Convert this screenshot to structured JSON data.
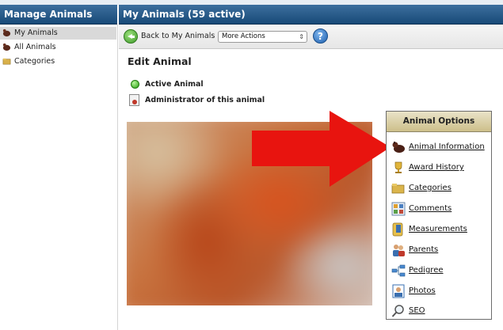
{
  "left_header": {
    "title": "Manage Animals"
  },
  "right_header": {
    "title": "My Animals (59 active)"
  },
  "sidebar": {
    "items": [
      {
        "label": "My Animals",
        "icon": "animal-icon",
        "active": true
      },
      {
        "label": "All Animals",
        "icon": "animal-icon",
        "active": false
      },
      {
        "label": "Categories",
        "icon": "folder-icon",
        "active": false
      }
    ]
  },
  "toolbar": {
    "back_label": "Back to My Animals",
    "more_actions_value": "More Actions",
    "help_label": "?"
  },
  "main": {
    "title": "Edit Animal",
    "status_active": "Active Animal",
    "status_admin": "Administrator of this animal"
  },
  "options": {
    "title": "Animal Options",
    "items": [
      {
        "label": "Animal Information",
        "icon": "animal-info-icon"
      },
      {
        "label": "Award History",
        "icon": "trophy-icon"
      },
      {
        "label": "Categories",
        "icon": "folder-icon"
      },
      {
        "label": "Comments",
        "icon": "comments-icon"
      },
      {
        "label": "Measurements",
        "icon": "measurements-icon"
      },
      {
        "label": "Parents",
        "icon": "parents-icon"
      },
      {
        "label": "Pedigree",
        "icon": "pedigree-icon"
      },
      {
        "label": "Photos",
        "icon": "photo-icon"
      },
      {
        "label": "SEO",
        "icon": "magnifier-icon"
      }
    ]
  },
  "colors": {
    "header_bar": "#24578a",
    "arrow": "#e8140f",
    "options_header": "#d8cc9c"
  }
}
